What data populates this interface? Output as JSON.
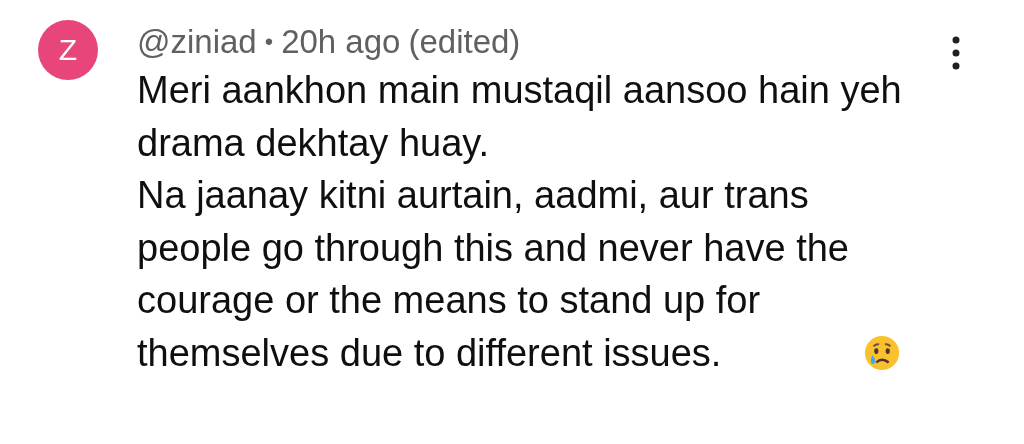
{
  "comment": {
    "avatar": {
      "letter": "Z",
      "color": "#e8467a"
    },
    "author": "@ziniad",
    "separator": "•",
    "time": "20h ago",
    "edited": "(edited)",
    "paragraphs": [
      [
        "Meri aankhon main mustaqil aansoo hain yeh",
        "drama dekhtay huay."
      ],
      [
        "Na jaanay kitni aurtain, aadmi, aur trans",
        "people go through this and never have the",
        "courage or the means to stand up for",
        "themselves due to different issues."
      ]
    ],
    "trailing_emoji": {
      "kind": "crying"
    }
  }
}
